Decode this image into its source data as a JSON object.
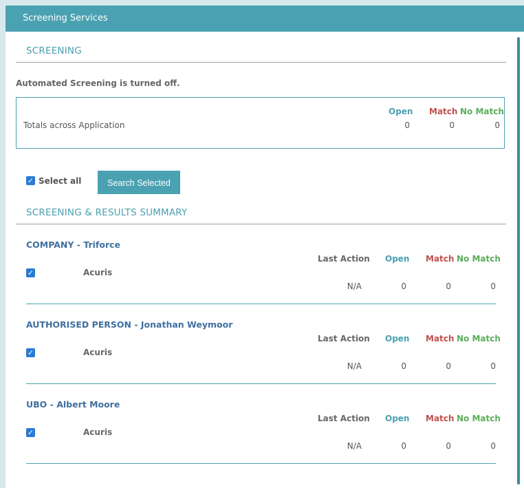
{
  "header": {
    "title": "Screening Services"
  },
  "screening": {
    "title": "SCREENING",
    "notice": "Automated Screening is turned off.",
    "totals": {
      "label": "Totals across Application",
      "open_label": "Open",
      "match_label": "Match",
      "nomatch_label": "No Match",
      "open": "0",
      "match": "0",
      "nomatch": "0"
    },
    "select_all_label": "Select all",
    "search_button": "Search Selected"
  },
  "summary": {
    "title": "SCREENING & RESULTS SUMMARY",
    "col_last_action": "Last Action",
    "col_open": "Open",
    "col_match": "Match",
    "col_nomatch": "No Match",
    "entities": [
      {
        "title": "COMPANY - Triforce",
        "provider": "Acuris",
        "last_action": "N/A",
        "open": "0",
        "match": "0",
        "nomatch": "0"
      },
      {
        "title": "AUTHORISED PERSON - Jonathan Weymoor",
        "provider": "Acuris",
        "last_action": "N/A",
        "open": "0",
        "match": "0",
        "nomatch": "0"
      },
      {
        "title": "UBO - Albert Moore",
        "provider": "Acuris",
        "last_action": "N/A",
        "open": "0",
        "match": "0",
        "nomatch": "0"
      }
    ]
  },
  "icons": {
    "checkbox": "checkmark-icon"
  }
}
